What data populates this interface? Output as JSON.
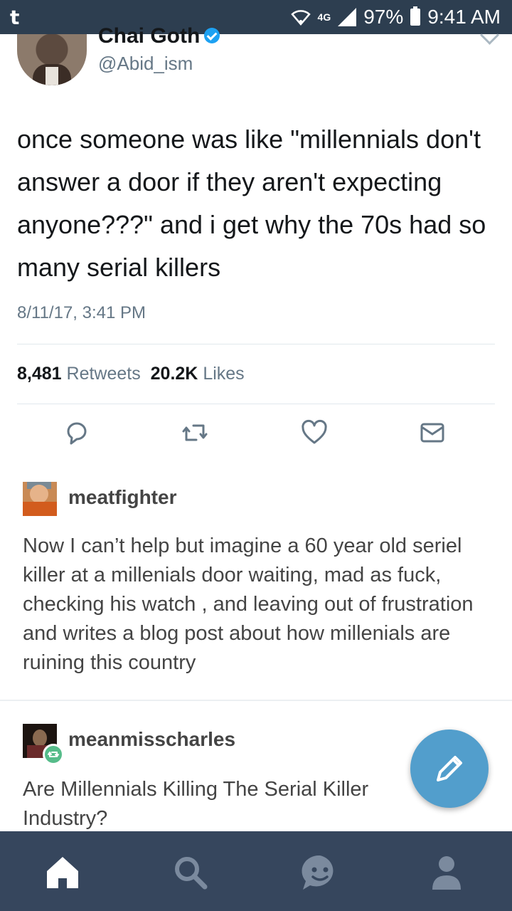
{
  "status_bar": {
    "app_icon": "t",
    "network": "4G",
    "battery": "97%",
    "time": "9:41 AM"
  },
  "tweet": {
    "display_name": "Chai Goth",
    "handle": "@Abid_ism",
    "text": "once someone was like \"millennials don't answer a door if they aren't expecting anyone???\" and i get why the 70s had so many serial killers",
    "date": "8/11/17, 3:41 PM",
    "retweets_count": "8,481",
    "retweets_label": "Retweets",
    "likes_count": "20.2K",
    "likes_label": "Likes",
    "actions": [
      "reply-icon",
      "retweet-icon",
      "like-icon",
      "dm-icon"
    ]
  },
  "posts": [
    {
      "username": "meatfighter",
      "body": "Now I can’t help but imagine a 60 year old seriel killer at a millenials door waiting, mad as fuck, checking his watch , and leaving out of frustration and writes a blog post about how millenials are ruining this country"
    },
    {
      "username": "meanmisscharles",
      "body": "Are Millennials Killing The Serial Killer Industry?"
    }
  ],
  "fab": {
    "icon": "pencil-icon"
  },
  "bottom_nav": {
    "items": [
      "home-icon",
      "search-icon",
      "messages-icon",
      "account-icon"
    ],
    "active": "home-icon"
  },
  "colors": {
    "status_bar": "#2d3e50",
    "bottom_nav": "#36465d",
    "fab": "#529ecc",
    "twitter_blue": "#1da1f2",
    "twitter_gray": "#657786"
  }
}
